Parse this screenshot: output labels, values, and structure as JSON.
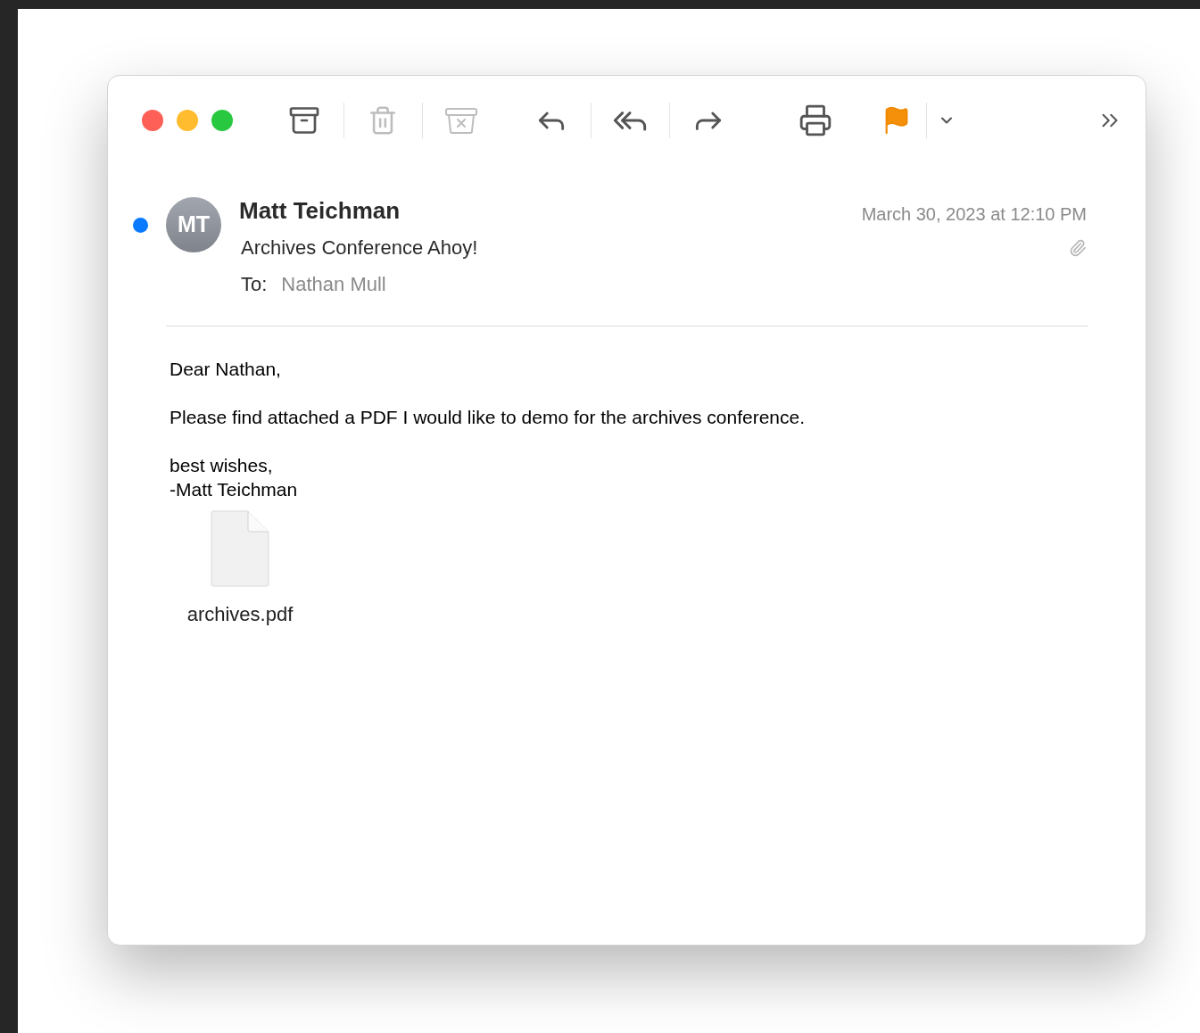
{
  "toolbar": [
    {
      "kind": "archive",
      "disabled": false,
      "divider_after": true
    },
    {
      "kind": "trash",
      "disabled": true,
      "divider_after": true
    },
    {
      "kind": "junk",
      "disabled": true,
      "divider_after": false
    },
    {
      "kind": "reply",
      "disabled": false,
      "divider_after": true
    },
    {
      "kind": "reply-all",
      "disabled": false,
      "divider_after": true
    },
    {
      "kind": "forward",
      "disabled": false,
      "divider_after": false
    },
    {
      "kind": "print",
      "disabled": false,
      "divider_after": false
    },
    {
      "kind": "flag",
      "disabled": false,
      "divider_after": true
    },
    {
      "kind": "flag-menu",
      "disabled": false,
      "divider_after": false
    }
  ],
  "message": {
    "unread": true,
    "initials": "MT",
    "sender": "Matt Teichman",
    "subject": "Archives Conference Ahoy!",
    "date": "March 30, 2023 at 12:10 PM",
    "to_label": "To:",
    "recipient": "Nathan Mull"
  },
  "body": [
    "Dear Nathan,",
    "Please find attached a PDF I would like to demo for the archives conference.",
    [
      "best wishes,",
      "-Matt Teichman"
    ]
  ],
  "attachment": {
    "filename": "archives.pdf"
  }
}
